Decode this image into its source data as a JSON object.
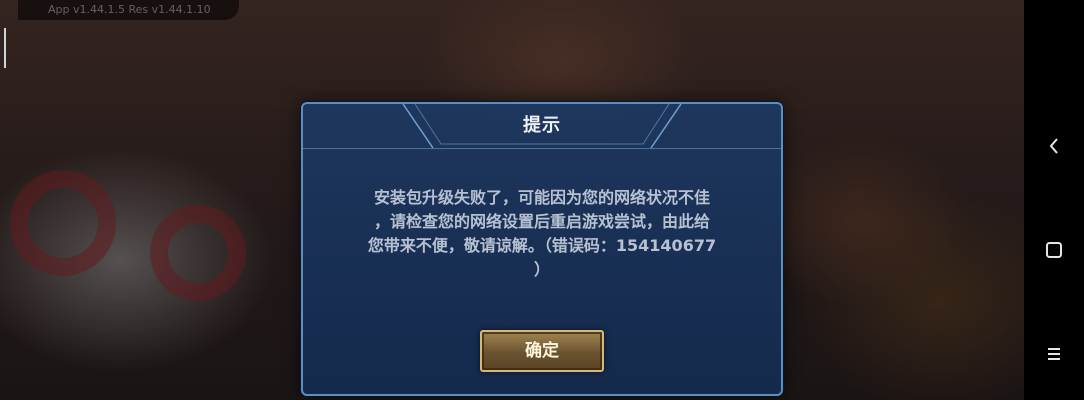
{
  "status": {
    "version_text": "App v1.44.1.5 Res v1.44.1.10"
  },
  "dialog": {
    "title": "提示",
    "message_lines": [
      "安装包升级失败了，可能因为您的网络状况不佳",
      "，请检查您的网络设置后重启游戏尝试，由此给",
      "您带来不便，敬请谅解。（错误码：154140677",
      "）"
    ],
    "confirm_label": "确定"
  },
  "nav": {
    "back_icon": "back-chevron-icon",
    "home_icon": "home-square-icon",
    "menu_icon": "menu-lines-icon"
  },
  "colors": {
    "dialog_border": "#5c8ec0",
    "dialog_bg": "#1e3860",
    "button_border": "#d6b774",
    "button_bg": "#6b5330",
    "message_text": "#b7c1d2"
  }
}
